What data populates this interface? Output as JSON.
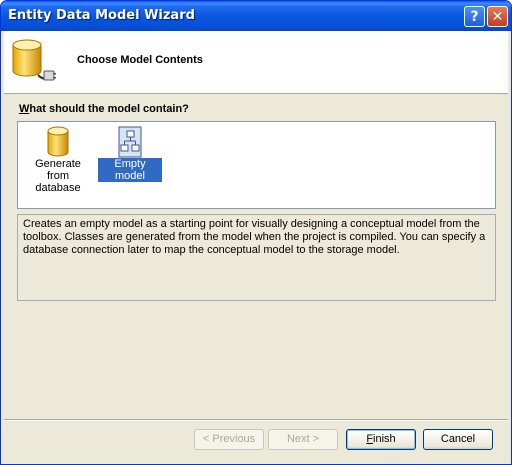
{
  "window": {
    "title": "Entity Data Model Wizard",
    "help_glyph": "?",
    "close_glyph": "✕"
  },
  "header": {
    "title": "Choose Model Contents",
    "icon": "database-plug-icon"
  },
  "question": {
    "first_letter": "W",
    "rest": "hat should the model contain?"
  },
  "options": [
    {
      "label": "Generate from database",
      "icon": "database-icon",
      "selected": false
    },
    {
      "label": "Empty model",
      "icon": "empty-model-icon",
      "selected": true
    }
  ],
  "description": "Creates an empty model as a starting point for visually designing a conceptual model from the toolbox. Classes are generated from the model when the project is compiled. You can specify a database connection later to map the conceptual model to the storage model.",
  "buttons": {
    "previous": "< Previous",
    "next": "Next >",
    "finish": "Finish",
    "cancel": "Cancel"
  },
  "colors": {
    "titlebar": "#0a5de8",
    "selection": "#316ac5",
    "dialog_bg": "#ece9d8"
  }
}
